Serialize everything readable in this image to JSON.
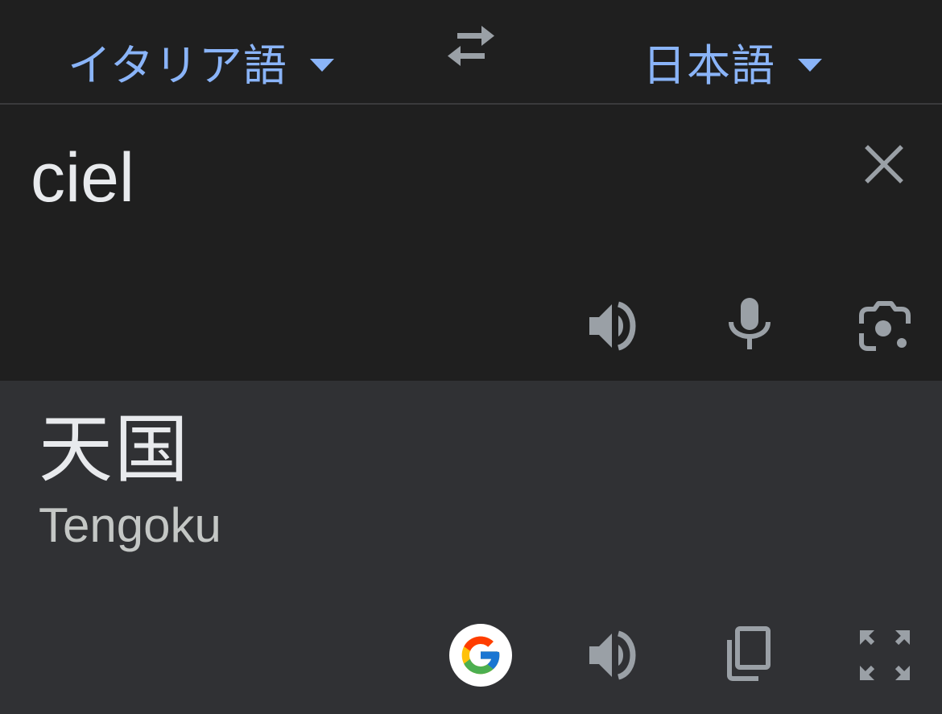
{
  "languages": {
    "source": "イタリア語",
    "target": "日本語"
  },
  "source": {
    "text": "ciel"
  },
  "result": {
    "text": "天国",
    "romanization": "Tengoku"
  },
  "icons": {
    "swap": "swap-horiz-icon",
    "clear": "close-icon",
    "source_listen": "volume-up-icon",
    "mic": "mic-icon",
    "camera": "camera-lens-icon",
    "google": "google-g-logo",
    "result_listen": "volume-up-icon",
    "copy": "copy-icon",
    "fullscreen": "fullscreen-icon"
  },
  "colors": {
    "accent": "#8ab4f8",
    "background": "#1f1f1f",
    "result_background": "#303134",
    "icon": "#9aa0a6",
    "text": "#e8eaed"
  }
}
